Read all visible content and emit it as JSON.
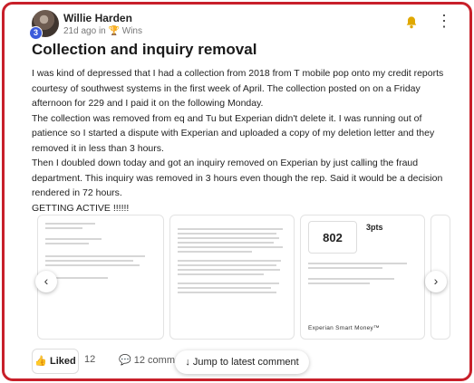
{
  "post": {
    "author": "Willie Harden",
    "level": "3",
    "time": "21d ago",
    "in_label": "in",
    "category": "Wins",
    "title": "Collection and inquiry removal",
    "paragraphs": [
      "I was kind of depressed that I had a collection from 2018 from T mobile pop onto my credit reports courtesy of southwest systems in the first week of April. The collection posted on on a Friday afternoon for 229 and I paid it on the following Monday.",
      "The collection was removed from eq and Tu but Experian didn't delete it. I was running out of patience so I started a dispute with Experian and uploaded a copy of my deletion letter and they removed it in less than 3 hours.",
      "Then I doubled down today and got an inquiry removed on Experian by just calling the fraud department. This inquiry was removed in 3 hours even though the rep. Said it would be a decision rendered in 72 hours.",
      "GETTING ACTIVE !!!!!!"
    ]
  },
  "carousel": {
    "score": "802",
    "score_change": "3pts",
    "brand": "Experian Smart Money™"
  },
  "footer": {
    "like_label": "Liked",
    "like_count": "12",
    "comments_label": "12 comme",
    "jump_label": "Jump to latest comment"
  },
  "colors": {
    "frame": "#c8202a",
    "level_badge": "#3b5bdb",
    "bell": "#e0a800"
  }
}
